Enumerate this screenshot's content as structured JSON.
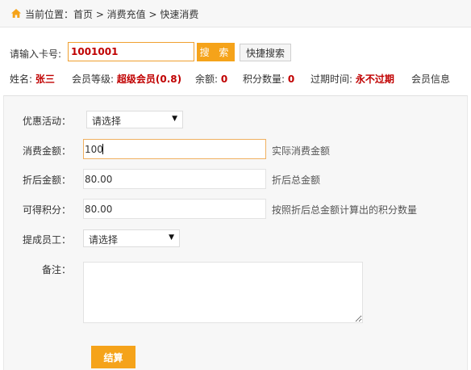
{
  "breadcrumb": {
    "text": "当前位置：首页 > 消费充值 > 快速消费",
    "icon": "home-icon"
  },
  "search": {
    "card_label": "请输入卡号:",
    "card_value": "1001001",
    "search_button": "搜 索",
    "quick_search_button": "快捷搜索"
  },
  "member": {
    "name_label": "姓名:",
    "name_value": "张三",
    "level_label": "会员等级:",
    "level_value": "超级会员(0.8)",
    "balance_label": "余额:",
    "balance_value": "0",
    "points_label": "积分数量:",
    "points_value": "0",
    "expiry_label": "过期时间:",
    "expiry_value": "永不过期",
    "info_link": "会员信息"
  },
  "form": {
    "promotion_label": "优惠活动：",
    "promotion_value": "请选择",
    "amount_label": "消费金额：",
    "amount_value": "100",
    "amount_hint": "实际消费金额",
    "discount_label": "折后金额：",
    "discount_value": "80.00",
    "discount_hint": "折后总金额",
    "points_label": "可得积分：",
    "points_value": "80.00",
    "points_hint": "按照折后总金额计算出的积分数量",
    "staff_label": "提成员工：",
    "staff_value": "请选择",
    "remark_label": "备注：",
    "submit_button": "结算"
  },
  "colors": {
    "accent": "#f5a31a",
    "highlight_red": "#c00000",
    "panel_bg": "#f7f7f7"
  }
}
